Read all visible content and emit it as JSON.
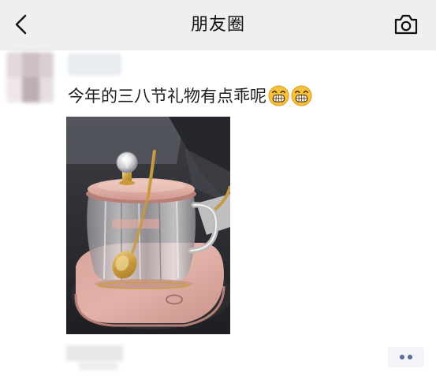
{
  "navbar": {
    "title": "朋友圈",
    "back_icon": "chevron-left-icon",
    "camera_icon": "camera-icon"
  },
  "post": {
    "text": "今年的三八节礼物有点乖呢",
    "emojis": [
      "grin-emoji",
      "grin-emoji"
    ],
    "photo_subject": "glass-cup-on-pink-warmer-photo"
  },
  "colors": {
    "navbar_bg": "#efefef",
    "accent": "#576b95",
    "text": "#1d1d1d"
  }
}
